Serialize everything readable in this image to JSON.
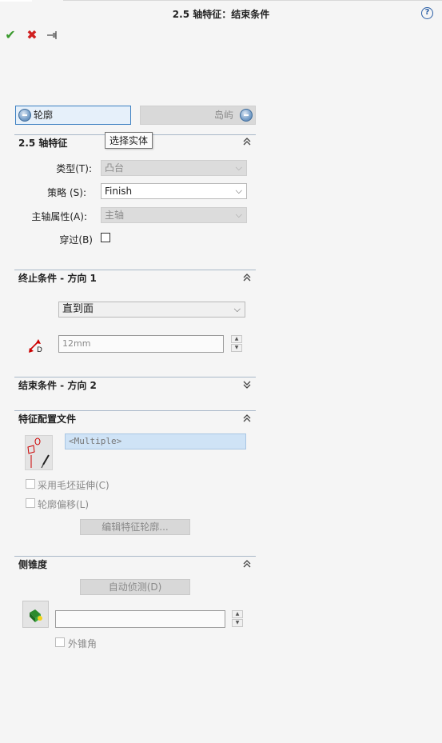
{
  "header": {
    "title": "2.5 轴特征：结束条件",
    "help_icon": "help-icon",
    "help_symbol": "?"
  },
  "toolbar": {
    "ok_symbol": "✔",
    "cancel_symbol": "✖",
    "pin_symbol": "⊸"
  },
  "selection_tabs": {
    "profile": "轮廓",
    "island": "岛屿"
  },
  "tooltip": "选择实体",
  "feature_25d": {
    "heading": "2.5 轴特征",
    "collapse_symbol": "⌃",
    "type_label": "类型(T):",
    "type_value": "凸台",
    "strategy_label": "策略 (S):",
    "strategy_value": "Finish",
    "spindle_label": "主轴属性(A):",
    "spindle_value": "主轴",
    "through_label": "穿过(B)",
    "through_checked": false
  },
  "end_condition_1": {
    "heading": "终止条件 - 方向 1",
    "condition_value": "直到面",
    "distance_value": "12mm",
    "distance_icon_letter": "D"
  },
  "end_condition_2": {
    "heading": "结束条件 - 方向 2"
  },
  "feature_profile": {
    "heading": "特征配置文件",
    "profile_value": "<Multiple>",
    "stock_extend_label": "采用毛坯延伸(C)",
    "profile_offset_label": "轮廓偏移(L)",
    "edit_button": "编辑特征轮廓..."
  },
  "side_taper": {
    "heading": "侧锥度",
    "auto_detect_button": "自动侦测(D)",
    "taper_value": "",
    "outer_taper_label": "外锥角"
  },
  "colors": {
    "accent": "#3c7fc1",
    "ok": "#3a9a2d",
    "cancel": "#d02020",
    "selection_highlight": "#cfe3f6"
  }
}
